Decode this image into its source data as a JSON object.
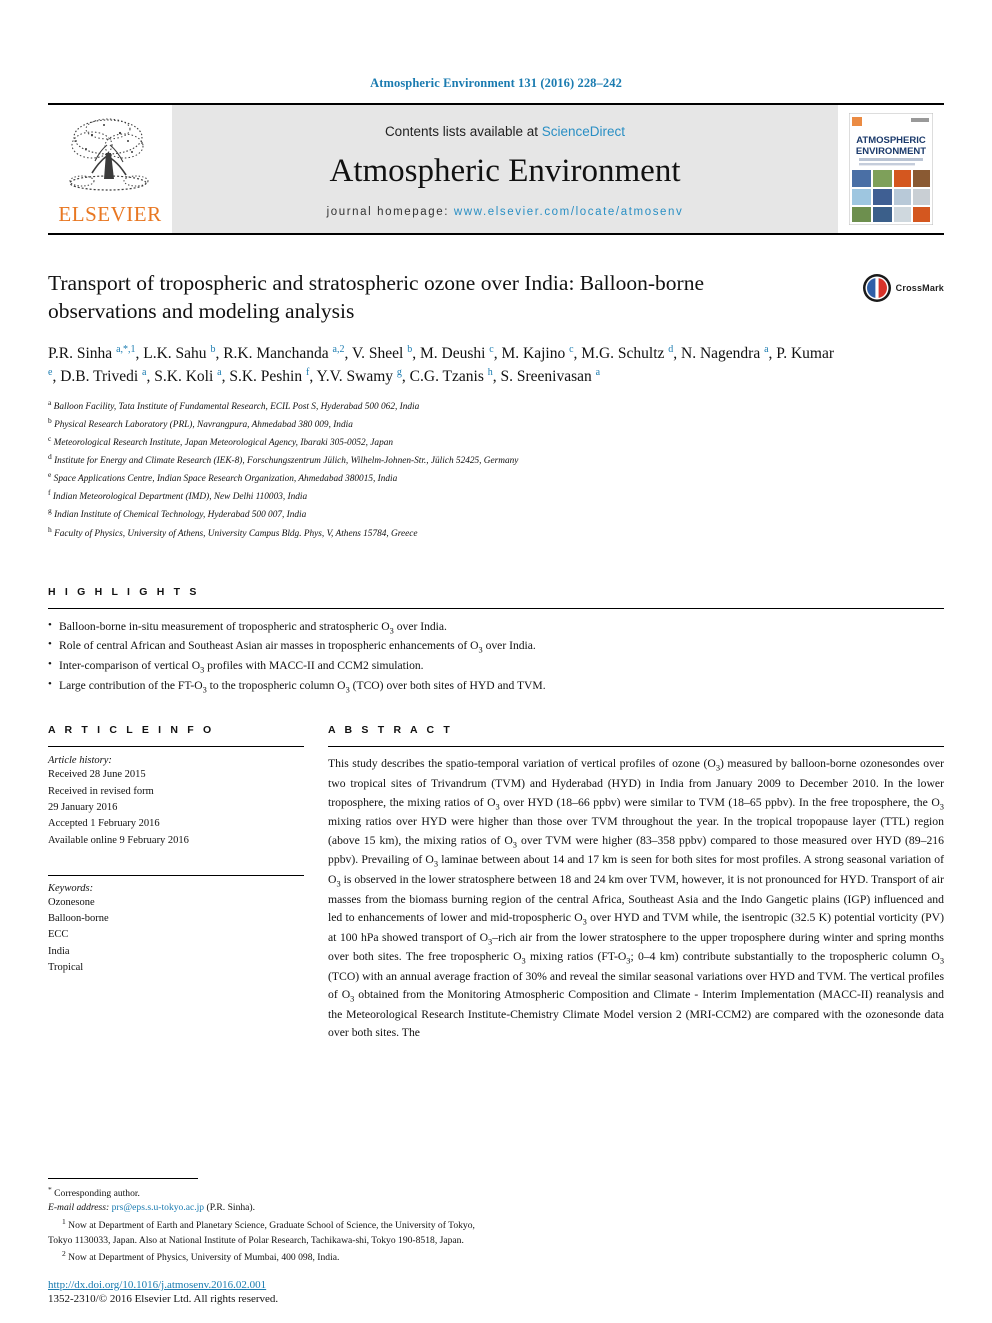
{
  "running_head": "Atmospheric Environment 131 (2016) 228–242",
  "masthead": {
    "publisher_name": "ELSEVIER",
    "contents_prefix": "Contents lists available at ",
    "contents_link": "ScienceDirect",
    "journal_title": "Atmospheric Environment",
    "homepage_prefix": "journal homepage: ",
    "homepage_link": "www.elsevier.com/locate/atmosenv",
    "cover_title_line1": "ATMOSPHERIC",
    "cover_title_line2": "ENVIRONMENT"
  },
  "article": {
    "title": "Transport of tropospheric and stratospheric ozone over India: Balloon-borne observations and modeling analysis",
    "crossmark_label": "CrossMark",
    "authors_html": "P.R. Sinha <sup>a,*,1</sup>, L.K. Sahu <sup>b</sup>, R.K. Manchanda <sup>a,2</sup>, V. Sheel <sup>b</sup>, M. Deushi <sup>c</sup>, M. Kajino <sup>c</sup>, M.G. Schultz <sup>d</sup>, N. Nagendra <sup>a</sup>, P. Kumar <sup>e</sup>, D.B. Trivedi <sup>a</sup>, S.K. Koli <sup>a</sup>, S.K. Peshin <sup>f</sup>, Y.V. Swamy <sup>g</sup>, C.G. Tzanis <sup>h</sup>, S. Sreenivasan <sup>a</sup>",
    "affiliations": [
      {
        "marker": "a",
        "text": "Balloon Facility, Tata Institute of Fundamental Research, ECIL Post S, Hyderabad 500 062, India"
      },
      {
        "marker": "b",
        "text": "Physical Research Laboratory (PRL), Navrangpura, Ahmedabad 380 009, India"
      },
      {
        "marker": "c",
        "text": "Meteorological Research Institute, Japan Meteorological Agency, Ibaraki 305-0052, Japan"
      },
      {
        "marker": "d",
        "text": "Institute for Energy and Climate Research (IEK-8), Forschungszentrum Jülich, Wilhelm-Johnen-Str., Jülich 52425, Germany"
      },
      {
        "marker": "e",
        "text": "Space Applications Centre, Indian Space Research Organization, Ahmedabad 380015, India"
      },
      {
        "marker": "f",
        "text": "Indian Meteorological Department (IMD), New Delhi 110003, India"
      },
      {
        "marker": "g",
        "text": "Indian Institute of Chemical Technology, Hyderabad 500 007, India"
      },
      {
        "marker": "h",
        "text": "Faculty of Physics, University of Athens, University Campus Bldg. Phys, V, Athens 15784, Greece"
      }
    ]
  },
  "highlights": {
    "heading": "H I G H L I G H T S",
    "items_html": [
      "Balloon-borne in-situ measurement of tropospheric and stratospheric O<sub>3</sub> over India.",
      "Role of central African and Southeast Asian air masses in tropospheric enhancements of O<sub>3</sub> over India.",
      "Inter-comparison of vertical O<sub>3</sub> profiles with MACC-II and CCM2 simulation.",
      "Large contribution of the FT-O<sub>3</sub> to the tropospheric column O<sub>3</sub> (TCO) over both sites of HYD and TVM."
    ]
  },
  "article_info": {
    "heading": "A R T I C L E  I N F O",
    "history_label": "Article history:",
    "history_lines": [
      "Received 28 June 2015",
      "Received in revised form",
      "29 January 2016",
      "Accepted 1 February 2016",
      "Available online 9 February 2016"
    ],
    "keywords_label": "Keywords:",
    "keywords": [
      "Ozonesone",
      "Balloon-borne",
      "ECC",
      "India",
      "Tropical"
    ]
  },
  "abstract": {
    "heading": "A B S T R A C T",
    "body_html": "This study describes the spatio-temporal variation of vertical profiles of ozone (O<sub>3</sub>) measured by balloon-borne ozonesondes over two tropical sites of Trivandrum (TVM) and Hyderabad (HYD) in India from January 2009 to December 2010. In the lower troposphere, the mixing ratios of O<sub>3</sub> over HYD (18&ndash;66 ppbv) were similar to TVM (18&ndash;65 ppbv). In the free troposphere, the O<sub>3</sub> mixing ratios over HYD were higher than those over TVM throughout the year. In the tropical tropopause layer (TTL) region (above 15 km), the mixing ratios of O<sub>3</sub> over TVM were higher (83&ndash;358 ppbv) compared to those measured over HYD (89&ndash;216 ppbv). Prevailing of O<sub>3</sub> laminae between about 14 and 17 km is seen for both sites for most profiles. A strong seasonal variation of O<sub>3</sub> is observed in the lower stratosphere between 18 and 24 km over TVM, however, it is not pronounced for HYD. Transport of air masses from the biomass burning region of the central Africa, Southeast Asia and the Indo Gangetic plains (IGP) influenced and led to enhancements of lower and mid-tropospheric O<sub>3</sub> over HYD and TVM while, the isentropic (32.5 K) potential vorticity (PV) at 100 hPa showed transport of O<sub>3</sub>&ndash;rich air from the lower stratosphere to the upper troposphere during winter and spring months over both sites. The free tropospheric O<sub>3</sub> mixing ratios (FT-O<sub>3</sub>; 0&ndash;4 km) contribute substantially to the tropospheric column O<sub>3</sub> (TCO) with an annual average fraction of 30% and reveal the similar seasonal variations over HYD and TVM. The vertical profiles of O<sub>3</sub> obtained from the Monitoring Atmospheric Composition and Climate - Interim Implementation (MACC-II) reanalysis and the Meteorological Research Institute-Chemistry Climate Model version 2 (MRI-CCM2) are compared with the ozonesonde data over both sites. The"
  },
  "footnotes": {
    "corresponding_marker": "*",
    "corresponding_text": "Corresponding author.",
    "email_label": "E-mail address:",
    "email": "prs@eps.s.u-tokyo.ac.jp",
    "email_suffix": "(P.R. Sinha).",
    "note1_marker": "1",
    "note1_text": "Now at Department of Earth and Planetary Science, Graduate School of Science, the University of Tokyo, Tokyo 1130033, Japan. Also at National Institute of Polar Research, Tachikawa-shi, Tokyo 190-8518, Japan.",
    "note2_marker": "2",
    "note2_text": "Now at Department of Physics, University of Mumbai, 400 098, India."
  },
  "publication": {
    "doi": "http://dx.doi.org/10.1016/j.atmosenv.2016.02.001",
    "copyright": "1352-2310/© 2016 Elsevier Ltd. All rights reserved."
  },
  "colors": {
    "link_blue": "#1a7bb0",
    "sciencedirect_blue": "#2a8fc4",
    "elsevier_orange": "#e87722"
  }
}
